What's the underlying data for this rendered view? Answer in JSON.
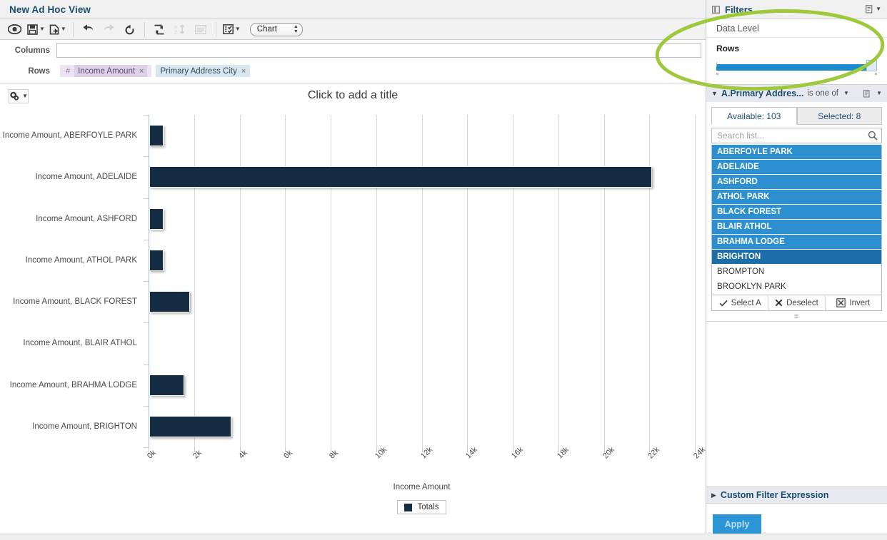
{
  "window": {
    "title": "New Ad Hoc View"
  },
  "toolbar": {
    "buttons": [
      {
        "name": "preview-icon",
        "label": "Preview"
      },
      {
        "name": "save-icon",
        "label": "Save"
      },
      {
        "name": "export-icon",
        "label": "Export"
      },
      {
        "name": "undo-icon",
        "label": "Undo"
      },
      {
        "name": "redo-icon",
        "label": "Redo"
      },
      {
        "name": "revert-icon",
        "label": "Revert"
      },
      {
        "name": "switch-group-icon",
        "label": "Switch Group"
      },
      {
        "name": "sort-icon",
        "label": "Sort"
      },
      {
        "name": "table-icon",
        "label": "Table"
      },
      {
        "name": "selector-icon",
        "label": "Display Options"
      }
    ],
    "chart_select": {
      "value": "Chart"
    }
  },
  "zones": {
    "columns_label": "Columns",
    "columns_items": [],
    "rows_label": "Rows",
    "rows_items": [
      {
        "prefix": "#",
        "label": "Income Amount",
        "type": "measure",
        "remove": "×"
      },
      {
        "prefix": "",
        "label": "Primary Address City",
        "type": "dimension",
        "remove": "×"
      }
    ]
  },
  "canvas": {
    "options_icon": "gear-icon",
    "title_placeholder": "Click to add a title"
  },
  "chart_data": {
    "type": "bar",
    "orientation": "horizontal",
    "title": "Click to add a title",
    "xlabel": "Income Amount",
    "ylabel": "",
    "xlim": [
      0,
      24000
    ],
    "xticks": [
      "0k",
      "2k",
      "4k",
      "6k",
      "8k",
      "10k",
      "12k",
      "14k",
      "16k",
      "18k",
      "20k",
      "22k",
      "24k"
    ],
    "xtick_values": [
      0,
      2000,
      4000,
      6000,
      8000,
      10000,
      12000,
      14000,
      16000,
      18000,
      20000,
      22000,
      24000
    ],
    "grid": true,
    "legend": {
      "position": "bottom",
      "entries": [
        "Totals"
      ]
    },
    "series_color": "#152b41",
    "categories": [
      "Income Amount, ABERFOYLE PARK",
      "Income Amount, ADELAIDE",
      "Income Amount, ASHFORD",
      "Income Amount, ATHOL PARK",
      "Income Amount, BLACK FOREST",
      "Income Amount, BLAIR ATHOL",
      "Income Amount, BRAHMA LODGE",
      "Income Amount, BRIGHTON"
    ],
    "series": [
      {
        "name": "Totals",
        "values": [
          620,
          22100,
          620,
          620,
          1800,
          0,
          1550,
          3620
        ]
      }
    ]
  },
  "filters": {
    "panel_title": "Filters",
    "panel_icon": "panel-collapse-icon",
    "menu_icon": "panel-menu-icon",
    "data_level_label": "Data Level",
    "rows_slider": {
      "label": "Rows",
      "fill_percent": 96
    },
    "block": {
      "name": "A.Primary Addres...",
      "operator": "is one of",
      "menu_icon": "filter-menu-icon",
      "tabs": [
        {
          "label": "Available: 103",
          "active": true
        },
        {
          "label": "Selected: 8",
          "active": false
        }
      ],
      "search_placeholder": "Search list...",
      "search_value": "",
      "search_icon": "search-icon",
      "items": [
        {
          "label": "ABERFOYLE PARK",
          "state": "selected"
        },
        {
          "label": "ADELAIDE",
          "state": "selected"
        },
        {
          "label": "ASHFORD",
          "state": "selected"
        },
        {
          "label": "ATHOL PARK",
          "state": "selected"
        },
        {
          "label": "BLACK FOREST",
          "state": "selected"
        },
        {
          "label": "BLAIR ATHOL",
          "state": "selected"
        },
        {
          "label": "BRAHMA LODGE",
          "state": "selected"
        },
        {
          "label": "BRIGHTON",
          "state": "focused"
        },
        {
          "label": "BROMPTON",
          "state": "normal"
        },
        {
          "label": "BROOKLYN PARK",
          "state": "normal"
        }
      ],
      "actions": [
        {
          "icon": "check-icon",
          "label": "Select A"
        },
        {
          "icon": "cross-icon",
          "label": "Deselect"
        },
        {
          "icon": "invert-icon",
          "label": "Invert"
        }
      ],
      "resize_handle": "="
    },
    "custom_filter_expression": "Custom Filter Expression",
    "apply_label": "Apply"
  },
  "colors": {
    "accent_blue": "#2b8fd0",
    "bar_navy": "#152b41",
    "title_blue": "#1b4f72",
    "annotation_green": "#9dc93b"
  }
}
